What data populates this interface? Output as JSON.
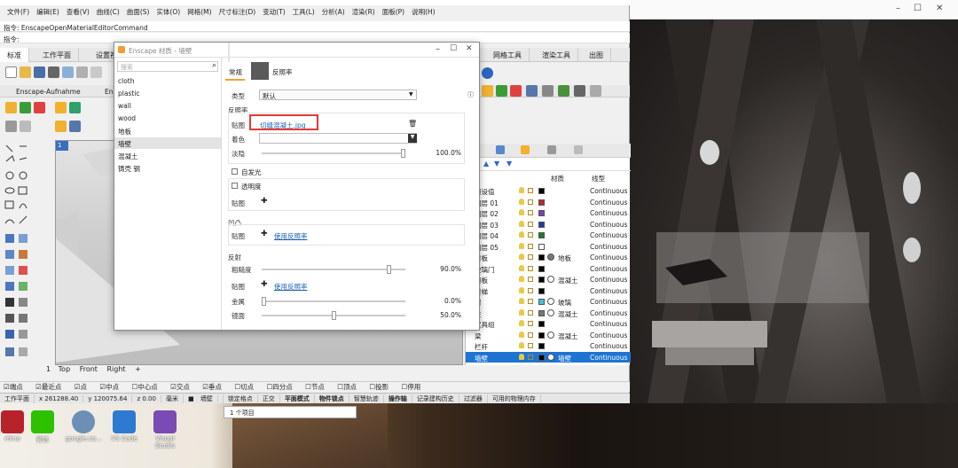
{
  "rhino": {
    "menu": [
      "文件(F)",
      "编辑(E)",
      "查看(V)",
      "曲线(C)",
      "曲面(S)",
      "实体(O)",
      "网格(M)",
      "尺寸标注(D)",
      "变动(T)",
      "工具(L)",
      "分析(A)",
      "渲染(R)",
      "面板(P)",
      "说明(H)"
    ],
    "command_history": "指令: EnscapeOpenMaterialEditorCommand",
    "command_prompt": "指令:",
    "tabs": [
      "标准",
      "工作平面",
      "设置视"
    ],
    "right_tabs": [
      "网格工具",
      "渲染工具",
      "出图"
    ],
    "tabs2": [
      "Enscape-Aufnahme",
      "En"
    ],
    "viewport_label": "1",
    "viewport_tabs": [
      "Top",
      "Front",
      "Right",
      "+"
    ],
    "snaps": [
      "端点",
      "最近点",
      "点",
      "中点",
      "中心点",
      "交点",
      "垂点",
      "切点",
      "四分点",
      "节点",
      "顶点",
      "投影",
      "停用"
    ],
    "status": [
      "工作平面",
      "x 261288.40",
      "y 120075.64",
      "z 0.00",
      "毫米",
      "墙壁",
      "锁定格点",
      "正交",
      "平面模式",
      "物件锁点",
      "智慧轨迹",
      "操作轴",
      "记录建构历史",
      "过滤器",
      "可用的物理内存"
    ],
    "status_popup": "1 个项目"
  },
  "layers": {
    "headers": {
      "material": "材质",
      "linetype": "线型"
    },
    "rows": [
      {
        "name": "预设值",
        "color": "#000000",
        "material": "",
        "linetype": "Continuous"
      },
      {
        "name": "图层 01",
        "color": "#c0282d",
        "material": "",
        "linetype": "Continuous"
      },
      {
        "name": "图层 02",
        "color": "#7b3fb8",
        "material": "",
        "linetype": "Continuous"
      },
      {
        "name": "图层 03",
        "color": "#1f3bb0",
        "material": "",
        "linetype": "Continuous"
      },
      {
        "name": "图层 04",
        "color": "#1f7a2a",
        "material": "",
        "linetype": "Continuous"
      },
      {
        "name": "图层 05",
        "color": "#ffffff",
        "material": "",
        "linetype": "Continuous"
      },
      {
        "name": "楼板",
        "color": "#000000",
        "material": "地板",
        "linetype": "Continuous"
      },
      {
        "name": "玻璃门",
        "color": "#000000",
        "material": "",
        "linetype": "Continuous"
      },
      {
        "name": "顶板",
        "color": "#000000",
        "material": "混凝土",
        "linetype": "Continuous"
      },
      {
        "name": "楼梯",
        "color": "#000000",
        "material": "",
        "linetype": "Continuous"
      },
      {
        "name": "窗",
        "color": "#3fc6d8",
        "material": "玻璃",
        "linetype": "Continuous"
      },
      {
        "name": "柱",
        "color": "#777777",
        "material": "混凝土",
        "linetype": "Continuous"
      },
      {
        "name": "家具组",
        "color": "#000000",
        "material": "",
        "linetype": "Continuous"
      },
      {
        "name": "梁",
        "color": "#000000",
        "material": "混凝土",
        "linetype": "Continuous"
      },
      {
        "name": "栏杆",
        "color": "#000000",
        "material": "",
        "linetype": "Continuous"
      },
      {
        "name": "墙壁",
        "color": "#000000",
        "material": "墙壁",
        "linetype": "Continuous",
        "selected": true
      }
    ]
  },
  "dialog": {
    "title": "Enscape 材质 - 墙壁",
    "search_placeholder": "搜索",
    "materials": [
      "cloth",
      "plastic",
      "wall",
      "wood",
      "地板",
      "墙壁",
      "混凝土",
      "铸壳 钢"
    ],
    "selected_material": "墙壁",
    "tabs": {
      "general": "常规",
      "reflect": "反照率"
    },
    "type_label": "类型",
    "type_value": "默认",
    "albedo_section": "反照率",
    "texture_label": "贴图",
    "texture_file": "切缝混凝土.jpg",
    "tint_label": "着色",
    "fade_label": "淡隐",
    "fade_value": "100.0%",
    "fade_level": 1.0,
    "emissive_label": "自发光",
    "transparency_label": "透明度",
    "transparency_texture_label": "贴图",
    "bump_section": "凹凸",
    "bump_texture_label": "贴图",
    "use_albedo_1": "使用反照率",
    "reflection_section": "反射",
    "roughness_label": "粗糙度",
    "roughness_value": "90.0%",
    "roughness_level": 0.9,
    "refl_texture_label": "贴图",
    "use_albedo_2": "使用反照率",
    "metal_label": "金属",
    "metal_value": "0.0%",
    "metal_level": 0.0,
    "specular_label": "镜面",
    "specular_value": "50.0%",
    "specular_level": 0.5
  },
  "desktop": {
    "icons": [
      "rhino",
      "微信",
      "google.co...",
      "VS Code",
      "Visual Studio"
    ]
  },
  "colors": {
    "highlight": "#e53935",
    "selection": "#1e74d2",
    "link": "#1a5fb4"
  }
}
